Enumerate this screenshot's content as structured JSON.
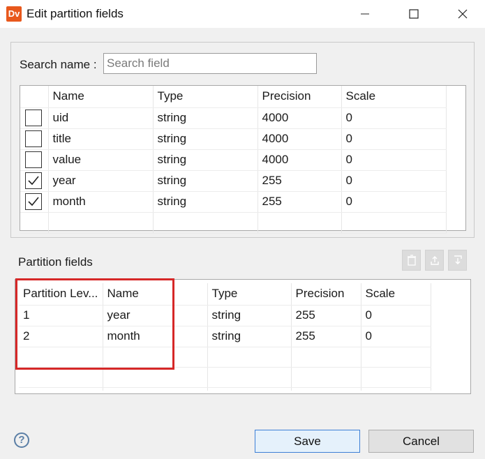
{
  "window": {
    "app_icon_text": "Dv",
    "title": "Edit partition fields",
    "minimize_glyph": "—",
    "maximize_glyph": "☐",
    "close_glyph": "✕"
  },
  "search": {
    "label": "Search name :",
    "placeholder": "Search field",
    "value": ""
  },
  "fields_table": {
    "columns": [
      "",
      "Name",
      "Type",
      "Precision",
      "Scale"
    ],
    "rows": [
      {
        "checked": false,
        "name": "uid",
        "type": "string",
        "precision": "4000",
        "scale": "0"
      },
      {
        "checked": false,
        "name": "title",
        "type": "string",
        "precision": "4000",
        "scale": "0"
      },
      {
        "checked": false,
        "name": "value",
        "type": "string",
        "precision": "4000",
        "scale": "0"
      },
      {
        "checked": true,
        "name": "year",
        "type": "string",
        "precision": "255",
        "scale": "0"
      },
      {
        "checked": true,
        "name": "month",
        "type": "string",
        "precision": "255",
        "scale": "0"
      }
    ]
  },
  "partition": {
    "label": "Partition fields",
    "toolbar": [
      "delete-icon",
      "move-up-icon",
      "move-down-icon"
    ],
    "columns": [
      "Partition Lev...",
      "Name",
      "",
      "Type",
      "Precision",
      "Scale"
    ],
    "rows": [
      {
        "level": "1",
        "name": "year",
        "type": "string",
        "precision": "255",
        "scale": "0"
      },
      {
        "level": "2",
        "name": "month",
        "type": "string",
        "precision": "255",
        "scale": "0"
      }
    ]
  },
  "buttons": {
    "help": "?",
    "save": "Save",
    "cancel": "Cancel"
  },
  "colors": {
    "highlight": "#d62828",
    "app_icon": "#e8581c",
    "save_border": "#3c7fd6"
  }
}
